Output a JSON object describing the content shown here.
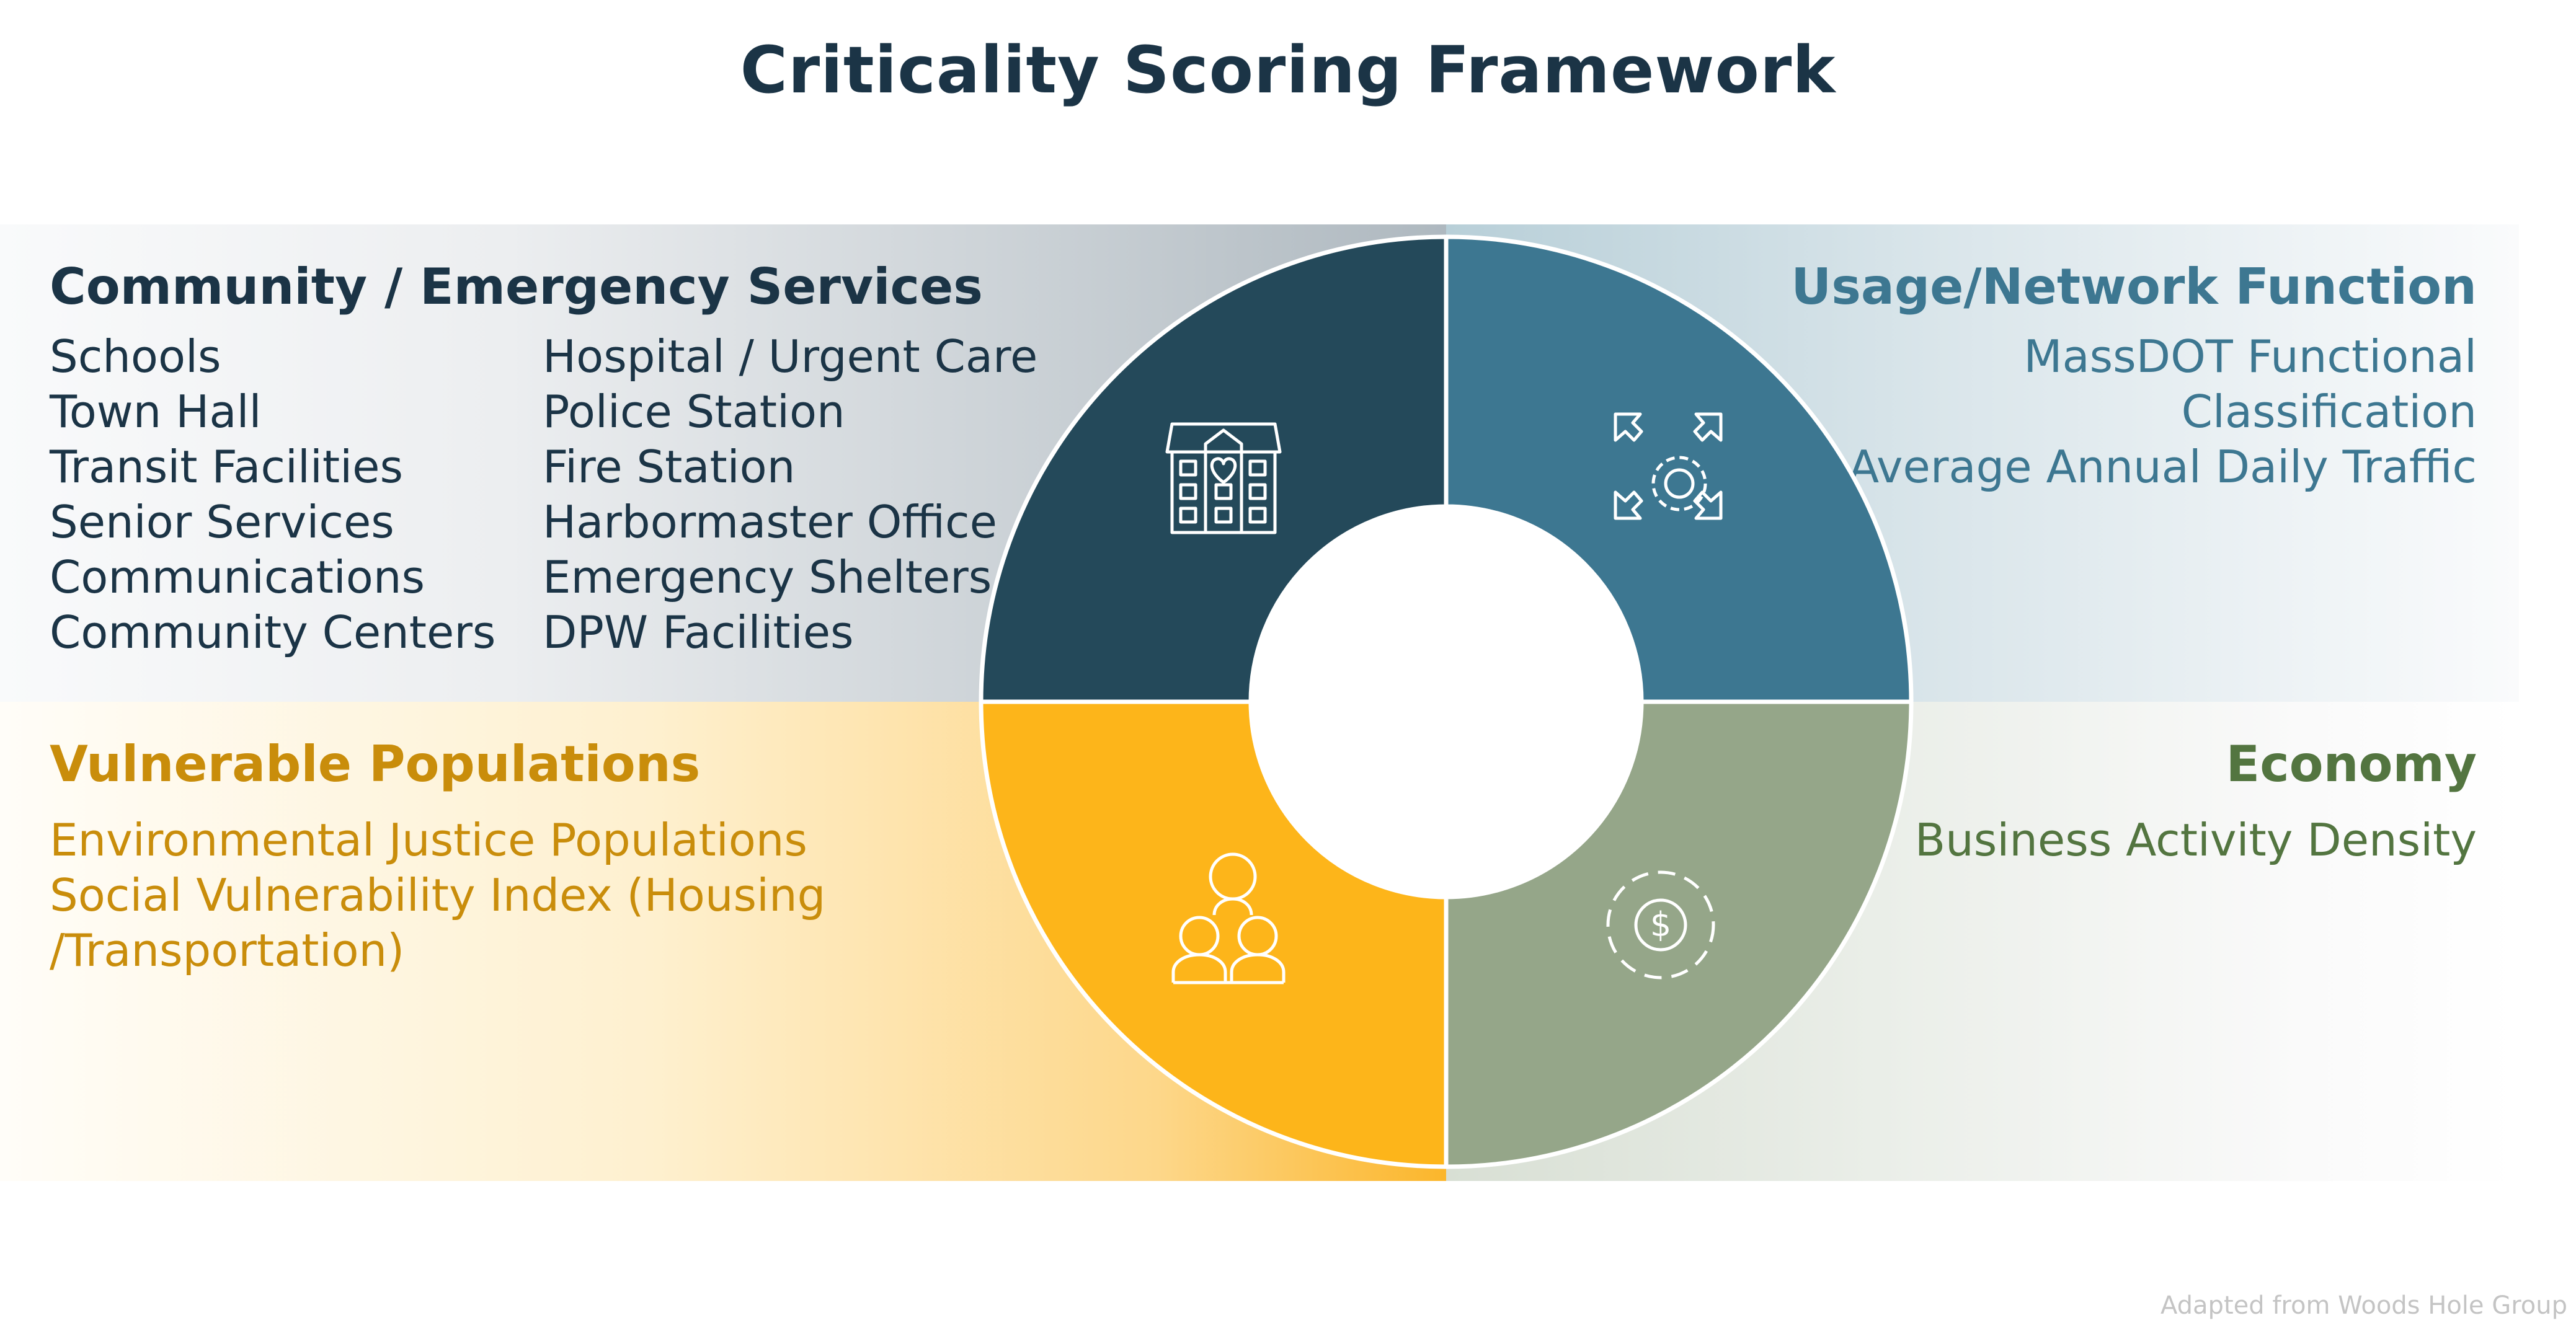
{
  "title": "Criticality Scoring Framework",
  "colors": {
    "title": "#1b3446",
    "community": "#24495a",
    "usage": "#3d7791",
    "vulnerable": "#fdb51a",
    "economy": "#95a689",
    "vulnerable_text": "#c98d0b",
    "economy_text": "#537540",
    "usage_text": "#3d7791",
    "community_text": "#1b3446"
  },
  "quadrants": {
    "community": {
      "heading": "Community / Emergency Services",
      "icon": "hospital-building-icon",
      "column1": [
        "Schools",
        "Town Hall",
        "Transit Facilities",
        "Senior Services",
        "Communications",
        "Community Centers"
      ],
      "column2": [
        "Hospital / Urgent Care",
        "Police Station",
        "Fire Station",
        "Harbormaster Office",
        "Emergency Shelters",
        "DPW Facilities"
      ]
    },
    "usage": {
      "heading": "Usage/Network Function",
      "icon": "gear-expand-arrows-icon",
      "items": [
        "MassDOT Functional",
        "Classification",
        "Average Annual Daily Traffic"
      ]
    },
    "vulnerable": {
      "heading": "Vulnerable Populations",
      "icon": "people-group-icon",
      "items": [
        "Environmental Justice Populations",
        "Social Vulnerability Index (Housing",
        "/Transportation)"
      ]
    },
    "economy": {
      "heading": "Economy",
      "icon": "gear-dollar-icon",
      "items": [
        "Business Activity Density"
      ]
    }
  },
  "footer": "Adapted from Woods Hole Group"
}
